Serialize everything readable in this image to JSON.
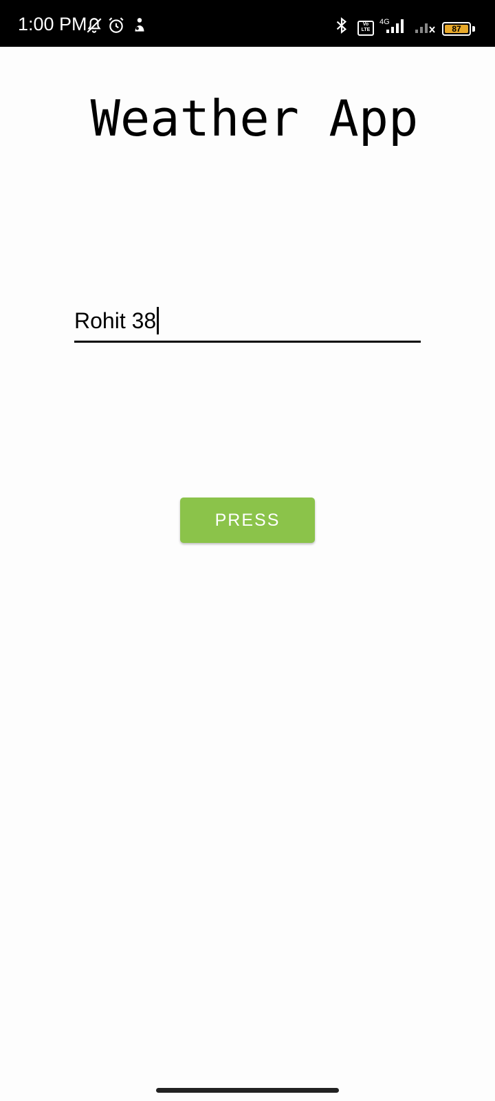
{
  "status_bar": {
    "time": "1:00 PM",
    "icons_left": [
      "notifications-off-icon",
      "alarm-icon",
      "app-notification-icon"
    ],
    "icons_right": [
      "bluetooth-icon",
      "volte-icon",
      "signal-icon",
      "signal-no-service-icon",
      "battery-icon"
    ],
    "volte_label": "Vo\nLTE",
    "network_type": "4G",
    "battery_level": "87",
    "battery_color": "#e8a92a"
  },
  "app": {
    "title": "Weather App",
    "input_value": "Rohit 38",
    "button_label": "PRESS",
    "button_color": "#8bc34a"
  }
}
